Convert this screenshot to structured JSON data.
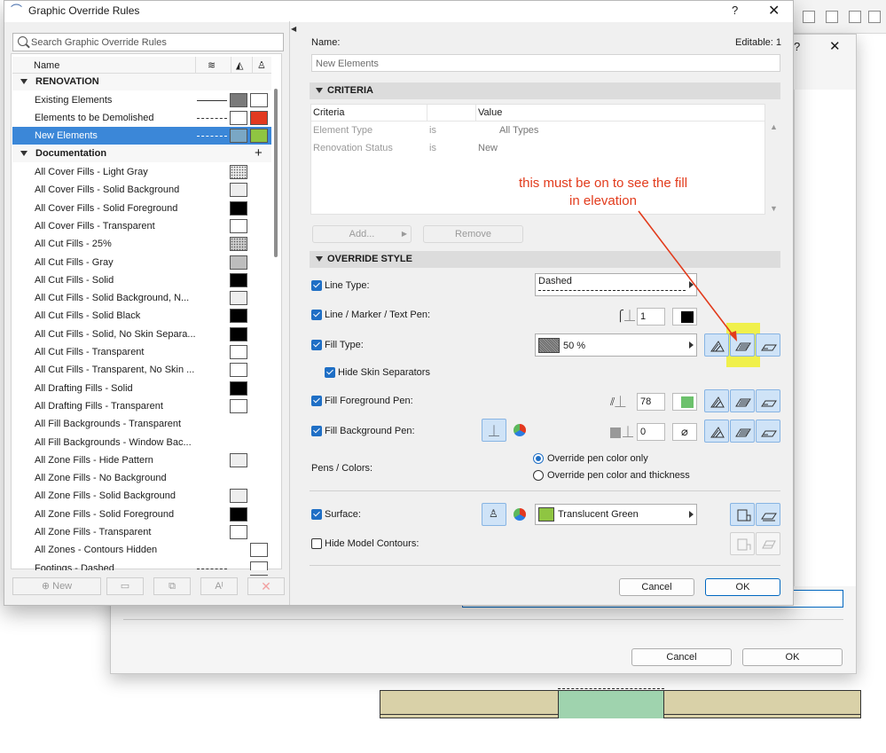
{
  "window": {
    "title": "Graphic Override Rules",
    "help": "?",
    "close": "✕"
  },
  "search": {
    "placeholder": "Search Graphic Override Rules"
  },
  "list_header": {
    "name": "Name"
  },
  "groups": [
    {
      "label": "RENOVATION"
    },
    {
      "label": "Documentation"
    }
  ],
  "renovation_items": [
    {
      "label": "Existing Elements",
      "line": "solid",
      "sw1": "#7a7a7a",
      "sw2": "#ffffff"
    },
    {
      "label": "Elements to be Demolished",
      "line": "dashed",
      "sw1": "#ffffff",
      "sw2": "#e2391f"
    },
    {
      "label": "New Elements",
      "line": "dashed",
      "sw1": "#7aa7c4",
      "sw2": "#8fc542"
    }
  ],
  "documentation_add": "+",
  "documentation_items": [
    {
      "label": "All Cover Fills - Light Gray",
      "fill": "#e9e9e9",
      "pattern": "dots"
    },
    {
      "label": "All Cover Fills - Solid Background",
      "fill": "#eeeeee"
    },
    {
      "label": "All Cover Fills - Solid Foreground",
      "fill": "#000000"
    },
    {
      "label": "All Cover Fills - Transparent",
      "fill": "#ffffff"
    },
    {
      "label": "All Cut Fills - 25%",
      "fill": "#cccccc",
      "pattern": "dots"
    },
    {
      "label": "All Cut Fills - Gray",
      "fill": "#bdbdbd"
    },
    {
      "label": "All Cut Fills - Solid",
      "fill": "#000000"
    },
    {
      "label": "All Cut Fills - Solid Background, N...",
      "fill": "#eeeeee"
    },
    {
      "label": "All Cut Fills - Solid Black",
      "fill": "#000000"
    },
    {
      "label": "All Cut Fills - Solid, No Skin Separa...",
      "fill": "#000000"
    },
    {
      "label": "All Cut Fills - Transparent",
      "fill": "#ffffff"
    },
    {
      "label": "All Cut Fills - Transparent, No Skin ...",
      "fill": "#ffffff"
    },
    {
      "label": "All Drafting Fills - Solid",
      "fill": "#000000"
    },
    {
      "label": "All Drafting Fills - Transparent",
      "fill": "#ffffff"
    },
    {
      "label": "All Fill Backgrounds - Transparent",
      "fill": ""
    },
    {
      "label": "All Fill Backgrounds - Window Bac...",
      "fill": ""
    },
    {
      "label": "All Zone Fills - Hide Pattern",
      "fill": "#eeeeee"
    },
    {
      "label": "All Zone Fills - No Background",
      "fill": ""
    },
    {
      "label": "All Zone Fills - Solid Background",
      "fill": "#eeeeee"
    },
    {
      "label": "All Zone Fills - Solid Foreground",
      "fill": "#000000"
    },
    {
      "label": "All Zone Fills - Transparent",
      "fill": "#ffffff"
    },
    {
      "label": "All Zones - Contours Hidden",
      "fill": "#ffffff",
      "offset": true
    },
    {
      "label": "Footings - Dashed",
      "fill": "#ffffff",
      "line": "dashed",
      "offset": true
    }
  ],
  "bottom_buttons": {
    "new": "New"
  },
  "detail": {
    "name_label": "Name:",
    "editable_label": "Editable: 1",
    "name_value": "New Elements",
    "criteria_section": "CRITERIA",
    "criteria_cols": {
      "criteria": "Criteria",
      "value": "Value"
    },
    "criteria_rows": [
      {
        "criteria": "Element Type",
        "op": "is",
        "value": "All Types"
      },
      {
        "criteria": "Renovation Status",
        "op": "is",
        "value": "New"
      }
    ],
    "add_btn": "Add...",
    "remove_btn": "Remove",
    "override_section": "OVERRIDE STYLE",
    "line_type_label": "Line Type:",
    "line_type_value": "Dashed",
    "line_pen_label": "Line / Marker / Text Pen:",
    "line_pen_value": "1",
    "fill_type_label": "Fill Type:",
    "fill_type_value": "50 %",
    "hide_skin_label": "Hide Skin Separators",
    "fill_fg_label": "Fill Foreground Pen:",
    "fill_fg_value": "78",
    "fill_bg_label": "Fill Background Pen:",
    "fill_bg_value": "0",
    "pens_colors_label": "Pens / Colors:",
    "radio_only": "Override pen color only",
    "radio_both": "Override pen color and thickness",
    "surface_label": "Surface:",
    "surface_value": "Translucent Green",
    "hide_contours_label": "Hide Model Contours:",
    "cancel": "Cancel",
    "ok": "OK"
  },
  "annotation": {
    "line1": "this must be on to see the fill",
    "line2": "in elevation"
  },
  "back_dialog": {
    "cancel": "Cancel",
    "ok": "OK",
    "help": "?",
    "close": "✕"
  },
  "colors": {
    "accent": "#1f6fc5",
    "selection": "#3b87d8",
    "annotation": "#e23b1c",
    "highlight": "#f0f014",
    "surface_green": "#8fc542",
    "fg_pen_green": "#6cc16c",
    "floor_beige": "#d9d1a8",
    "floor_glass": "#9fd3ae"
  }
}
